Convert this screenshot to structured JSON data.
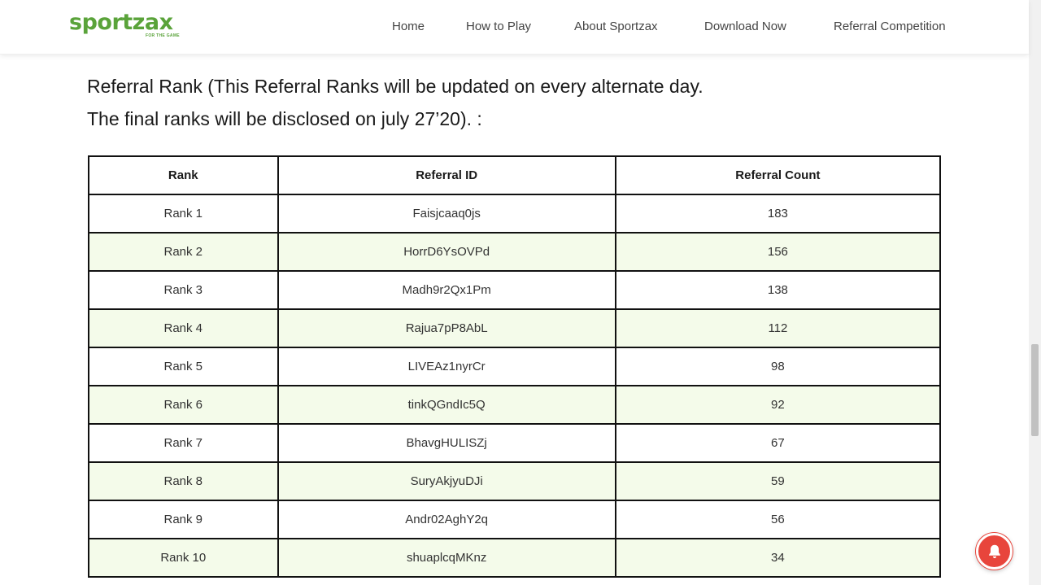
{
  "header": {
    "logo_text": "sportzax",
    "logo_tagline": "FOR THE GAME",
    "nav": [
      "Home",
      "How to Play",
      "About Sportzax",
      "Download Now",
      "Referral Competition"
    ]
  },
  "heading": {
    "line1": "Referral Rank (This Referral Ranks will be updated on every alternate day.",
    "line2": "The final ranks will be disclosed on july 27’20). :"
  },
  "table": {
    "columns": [
      "Rank",
      "Referral ID",
      "Referral Count"
    ],
    "rows": [
      [
        "Rank 1",
        "Faisjcaaq0js",
        "183"
      ],
      [
        "Rank 2",
        "HorrD6YsOVPd",
        "156"
      ],
      [
        "Rank 3",
        "Madh9r2Qx1Pm",
        "138"
      ],
      [
        "Rank 4",
        "Rajua7pP8AbL",
        "112"
      ],
      [
        "Rank 5",
        "LIVEAz1nyrCr",
        "98"
      ],
      [
        "Rank 6",
        "tinkQGndIc5Q",
        "92"
      ],
      [
        "Rank 7",
        "BhavgHULISZj",
        "67"
      ],
      [
        "Rank 8",
        "SuryAkjyuDJi",
        "59"
      ],
      [
        "Rank 9",
        "Andr02AghY2q",
        "56"
      ],
      [
        "Rank 10",
        "shuaplcqMKnz",
        "34"
      ]
    ]
  },
  "notification_icon": "bell-icon",
  "colors": {
    "brand": "#5aa33a",
    "alt_row": "#f4fbea",
    "notify": "#e8453c"
  }
}
